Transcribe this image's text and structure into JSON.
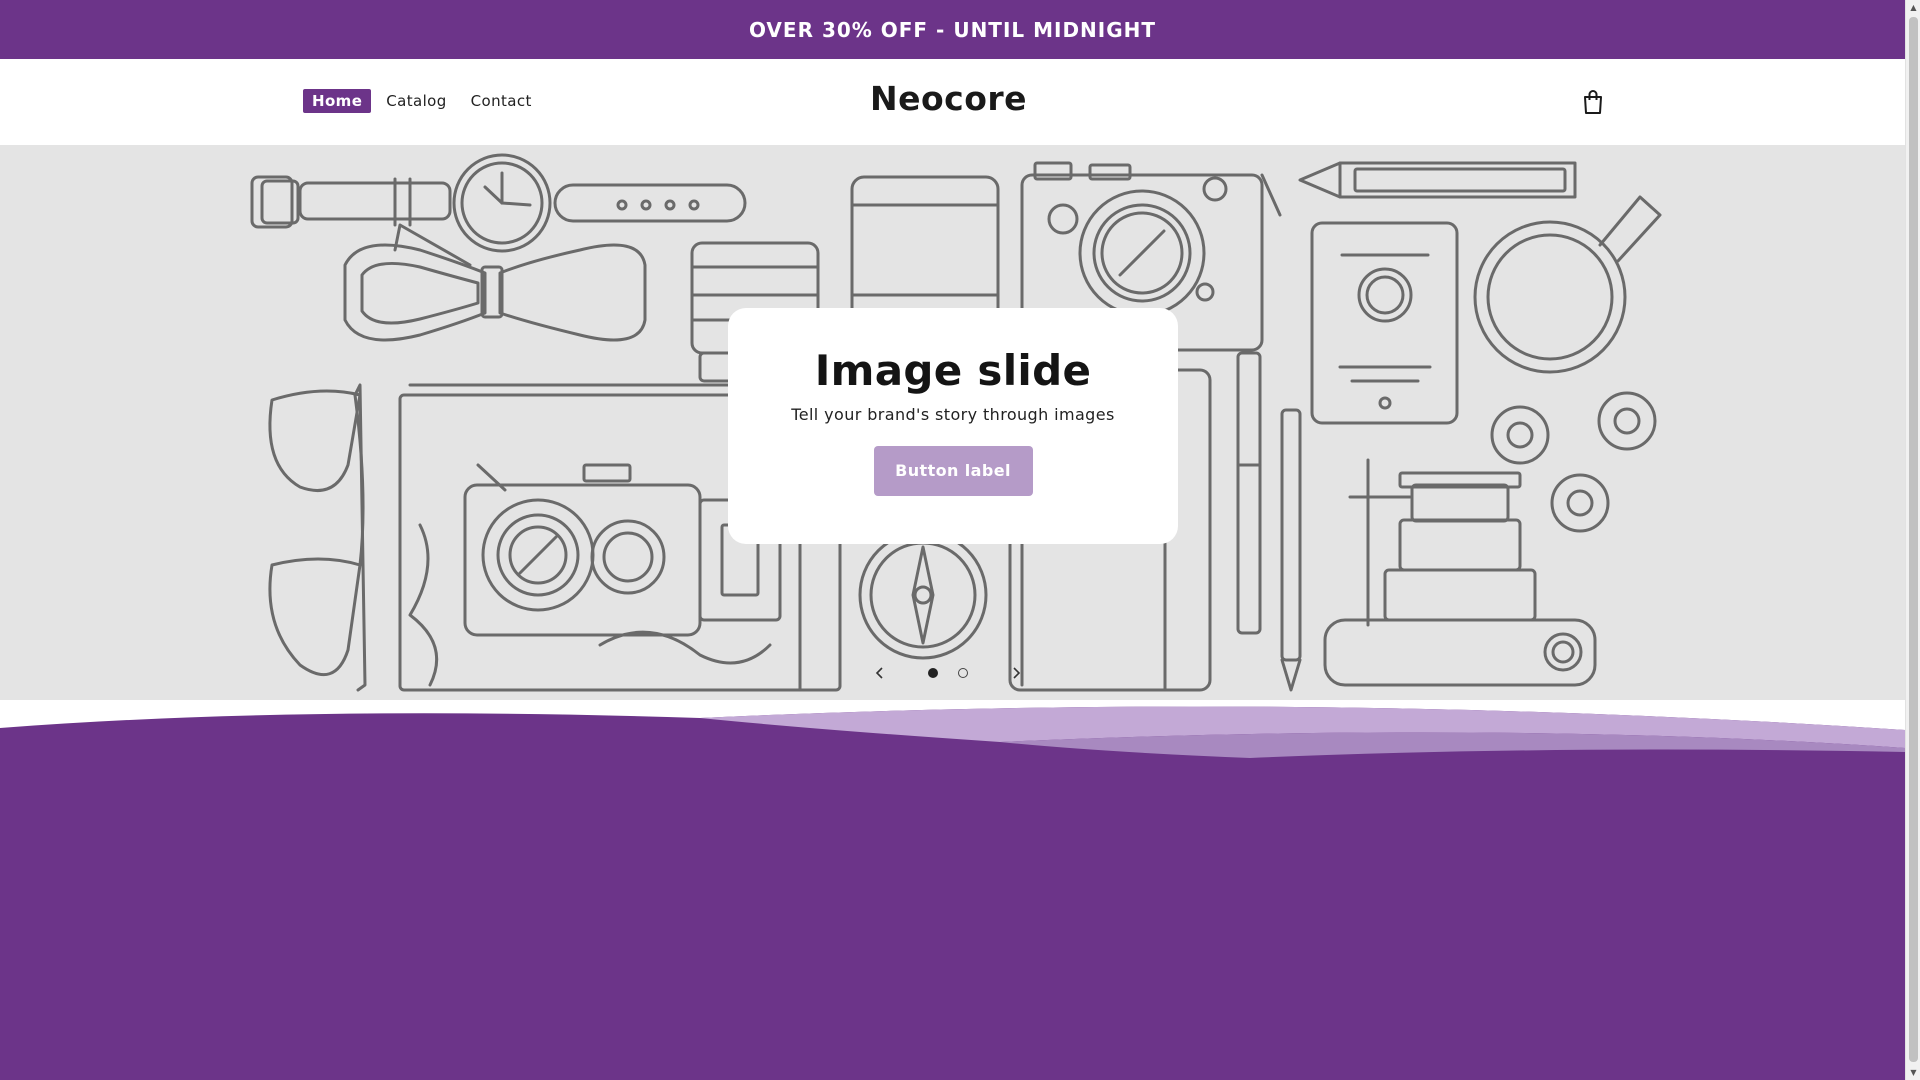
{
  "announcement": {
    "text": "OVER 30% OFF - UNTIL MIDNIGHT"
  },
  "header": {
    "brand": "Neocore",
    "nav": [
      {
        "label": "Home",
        "active": true
      },
      {
        "label": "Catalog",
        "active": false
      },
      {
        "label": "Contact",
        "active": false
      }
    ],
    "cart_icon": "shopping-bag-icon"
  },
  "hero": {
    "title": "Image slide",
    "subtitle": "Tell your brand's story through images",
    "button_label": "Button label",
    "prev_icon": "chevron-left-icon",
    "next_icon": "chevron-right-icon",
    "slides": [
      {
        "active": true
      },
      {
        "active": false
      }
    ]
  },
  "colors": {
    "brand_purple": "#6c3489",
    "button_lavender": "#b59bc8",
    "hero_background": "#e4e4e4"
  }
}
